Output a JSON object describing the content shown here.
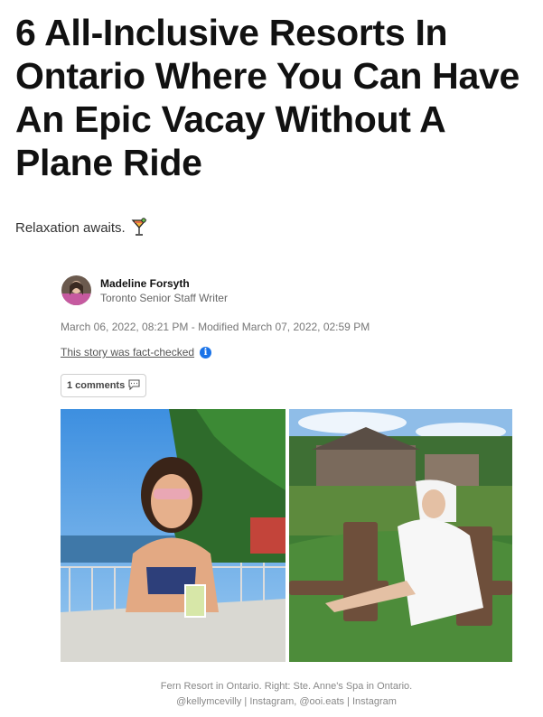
{
  "article": {
    "title": "6 All-Inclusive Resorts In Ontario Where You Can Have An Epic Vacay Without A Plane Ride",
    "subtitle": "Relaxation awaits.",
    "subtitle_icon": "cocktail-icon"
  },
  "author": {
    "name": "Madeline Forsyth",
    "role": "Toronto Senior Staff Writer"
  },
  "meta": {
    "published": "March 06, 2022, 08:21 PM",
    "modified": " - Modified March 07, 2022, 02:59 PM",
    "fact_check": "This story was fact-checked",
    "info_icon": "i"
  },
  "comments": {
    "label": "1 comments",
    "icon": "comment-icon"
  },
  "caption": {
    "line1": "Fern Resort in Ontario. Right: Ste. Anne's Spa in Ontario.",
    "line2": "@kellymcevilly | Instagram, @ooi.eats | Instagram"
  },
  "colors": {
    "info_blue": "#1a73e8",
    "caption_gray": "#888888"
  }
}
